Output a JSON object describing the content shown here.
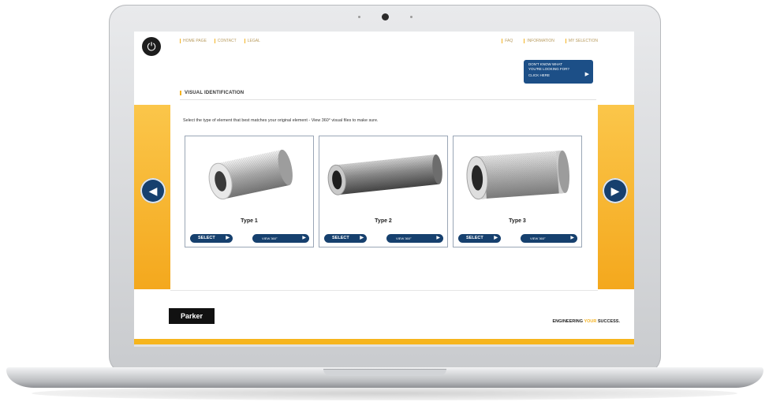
{
  "header": {
    "home_icon": "power-icon",
    "nav_left": [
      "HOME PAGE",
      "CONTACT",
      "LEGAL"
    ],
    "nav_right": [
      "FAQ",
      "INFORMATION",
      "MY SELECTION"
    ],
    "info_button": {
      "line1": "DON'T KNOW WHAT",
      "line2": "YOU'RE LOOKING FOR?",
      "line3": "CLICK HERE"
    }
  },
  "section": {
    "title": "VISUAL IDENTIFICATION",
    "instruction": "Select the type of element that best matches your original element - View 360° visual files to make sure."
  },
  "cards": [
    {
      "label": "Type 1",
      "select_label": "SELECT",
      "view_label": "VIEW 360°"
    },
    {
      "label": "Type 2",
      "select_label": "SELECT",
      "view_label": "VIEW 360°"
    },
    {
      "label": "Type 3",
      "select_label": "SELECT",
      "view_label": "VIEW 360°"
    }
  ],
  "nav_arrows": {
    "prev_icon": "chevron-left-icon",
    "next_icon": "chevron-right-icon"
  },
  "footer": {
    "logo": "Parker",
    "tagline_pre": "ENGINEERING ",
    "tagline_accent": "YOUR",
    "tagline_post": " SUCCESS."
  },
  "colors": {
    "brand_blue": "#16406e",
    "accent_yellow": "#f4b323"
  }
}
